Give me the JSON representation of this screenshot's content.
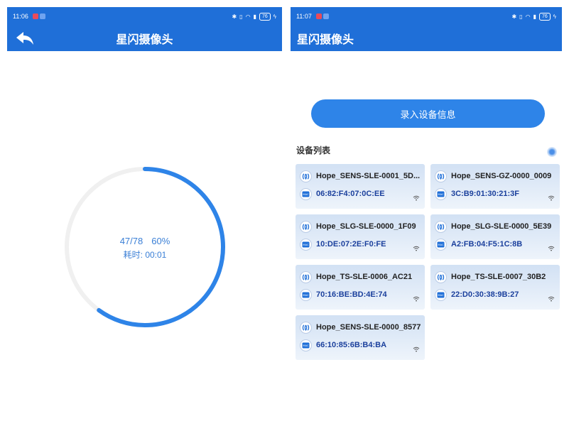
{
  "left": {
    "status": {
      "time": "11:06",
      "battery": "76"
    },
    "app_title": "星闪摄像头",
    "progress": {
      "count": "47/78",
      "percent": "60%",
      "elapsed_label": "耗时:",
      "elapsed_value": "00:01",
      "fraction": 0.6
    }
  },
  "right": {
    "status": {
      "time": "11:07",
      "battery": "76"
    },
    "app_title": "星闪摄像头",
    "enroll_button": "录入设备信息",
    "list_title": "设备列表",
    "devices": [
      {
        "name": "Hope_SENS-SLE-0001_5D...",
        "mac": "06:82:F4:07:0C:EE"
      },
      {
        "name": "Hope_SENS-GZ-0000_0009",
        "mac": "3C:B9:01:30:21:3F"
      },
      {
        "name": "Hope_SLG-SLE-0000_1F09",
        "mac": "10:DE:07:2E:F0:FE"
      },
      {
        "name": "Hope_SLG-SLE-0000_5E39",
        "mac": "A2:FB:04:F5:1C:8B"
      },
      {
        "name": "Hope_TS-SLE-0006_AC21",
        "mac": "70:16:BE:BD:4E:74"
      },
      {
        "name": "Hope_TS-SLE-0007_30B2",
        "mac": "22:D0:30:38:9B:27"
      },
      {
        "name": "Hope_SENS-SLE-0000_8577",
        "mac": "66:10:85:6B:B4:BA"
      }
    ],
    "icons": {
      "device": "sle-device-icon",
      "mac": "mac-address-icon",
      "signal": "wifi-signal-icon"
    }
  },
  "colors": {
    "app_bar": "#1f6fd8",
    "accent": "#2e84e8",
    "progress_track": "#f0f0f0",
    "mac_text": "#1a3f9c"
  }
}
